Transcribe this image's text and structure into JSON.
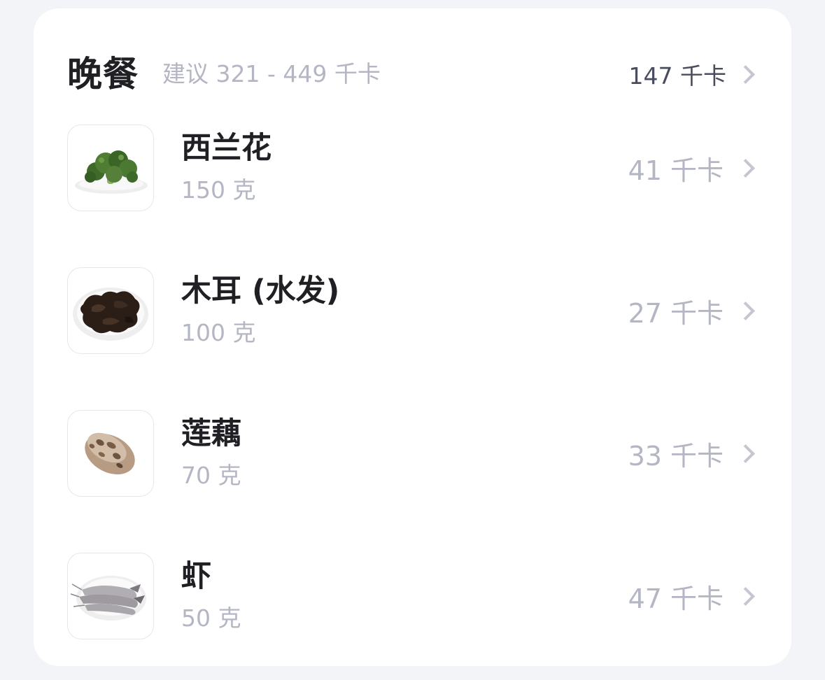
{
  "meal": {
    "title": "晚餐",
    "suggestion": "建议 321 - 449 千卡",
    "total": "147 千卡"
  },
  "foods": [
    {
      "name": "西兰花",
      "amount": "150 克",
      "kcal": "41 千卡",
      "icon": "broccoli-image"
    },
    {
      "name": "木耳 (水发)",
      "amount": "100 克",
      "kcal": "27 千卡",
      "icon": "wood-ear-image"
    },
    {
      "name": "莲藕",
      "amount": "70 克",
      "kcal": "33 千卡",
      "icon": "lotus-root-image"
    },
    {
      "name": "虾",
      "amount": "50 克",
      "kcal": "47 千卡",
      "icon": "shrimp-image"
    }
  ]
}
